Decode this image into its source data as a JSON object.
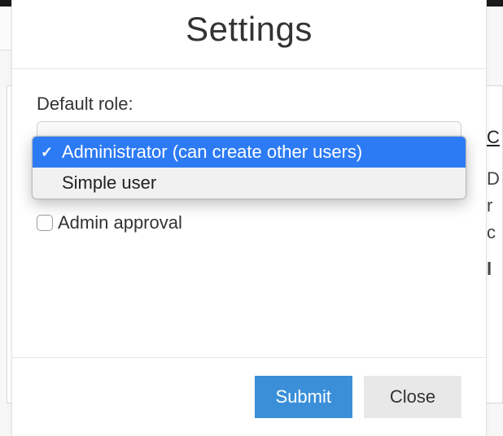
{
  "modal": {
    "title": "Settings",
    "fields": {
      "default_role": {
        "label": "Default role:",
        "options": [
          {
            "label": "Administrator (can create other users)",
            "selected": true
          },
          {
            "label": "Simple user",
            "selected": false
          }
        ]
      },
      "admin_approval": {
        "label": "Admin approval",
        "checked": false
      }
    },
    "buttons": {
      "submit": "Submit",
      "close": "Close"
    }
  },
  "background": {
    "header_fragment": "C",
    "lines": [
      "D",
      "r",
      "c",
      "",
      "l"
    ]
  },
  "colors": {
    "primary": "#3a8fd8",
    "dropdown_highlight": "#2d7bf4",
    "border": "#e6e6e6"
  }
}
